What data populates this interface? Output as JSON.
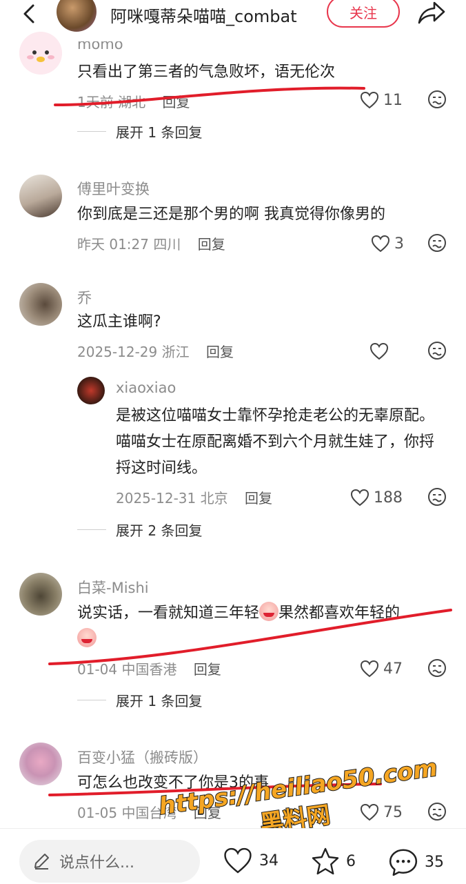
{
  "header": {
    "title": "阿咪嘎蒂朵喵喵_combat",
    "follow_label": "关注"
  },
  "comments": [
    {
      "user": "momo",
      "text": "只看出了第三者的气急败坏，语无伦次",
      "time": "1天前",
      "location": "湖北",
      "reply": "回复",
      "likes": "11",
      "expand": "展开 1 条回复"
    },
    {
      "user": "傅里叶变换",
      "text": "你到底是三还是那个男的啊 我真觉得你像男的",
      "time": "昨天 01:27",
      "location": "四川",
      "reply": "回复",
      "likes": "3"
    },
    {
      "user": "乔",
      "text": "这瓜主谁啊?",
      "time": "2025-12-29",
      "location": "浙江",
      "reply": "回复",
      "likes": ""
    },
    {
      "user": "xiaoxiao",
      "text": "是被这位喵喵女士靠怀孕抢走老公的无辜原配。喵喵女士在原配离婚不到六个月就生娃了，你捋捋这时间线。",
      "time": "2025-12-31",
      "location": "北京",
      "reply": "回复",
      "likes": "188",
      "expand": "展开 2 条回复"
    },
    {
      "user": "白菜-Mishi",
      "text": "说实话，一看就知道三年轻",
      "text2": "果然都喜欢年轻的",
      "time": "01-04",
      "location": "中国香港",
      "reply": "回复",
      "likes": "47",
      "expand": "展开 1 条回复"
    },
    {
      "user": "百变小猛（搬砖版）",
      "text": "可怎么也改变不了你是3的事",
      "time": "01-05",
      "location": "中国台湾",
      "reply": "回复",
      "likes": "75"
    }
  ],
  "watermark": {
    "line1": "https://heiliao50.com",
    "line2": "黑料网"
  },
  "bottom_bar": {
    "input_placeholder": "说点什么...",
    "likes": "34",
    "stars": "6",
    "comments": "35"
  }
}
